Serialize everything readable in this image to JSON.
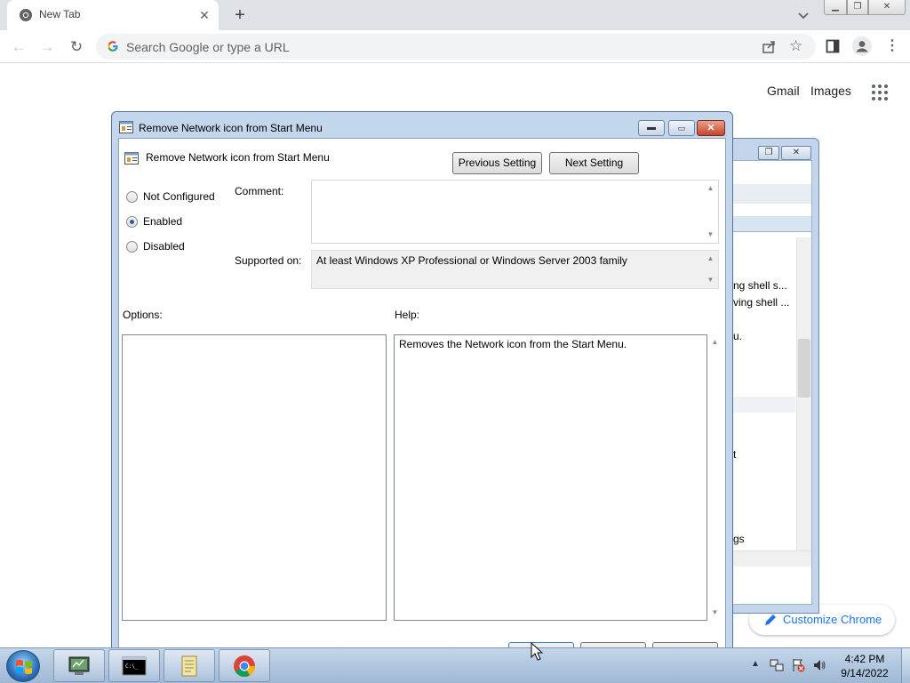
{
  "browser": {
    "tab": {
      "title": "New Tab",
      "close_glyph": "✕"
    },
    "new_tab_glyph": "+",
    "window_controls": {
      "minimize": "▁",
      "maximize": "❐",
      "close": "✕"
    },
    "nav": {
      "back": "←",
      "forward": "→",
      "reload": "↻"
    },
    "omnibox": {
      "placeholder": "Search Google or type a URL",
      "value": ""
    },
    "star_glyph": "☆",
    "menu_glyph": "⋮"
  },
  "new_tab_page": {
    "links": {
      "gmail": "Gmail",
      "images": "Images"
    },
    "customize_label": "Customize Chrome"
  },
  "background_window": {
    "lines": [
      "ng shell s...",
      "ving shell ...",
      "u.",
      "t",
      "gs"
    ],
    "buttons": {
      "restore": "❐",
      "close": "✕"
    }
  },
  "dialog": {
    "title": "Remove Network icon from Start Menu",
    "setting_name": "Remove Network icon from Start Menu",
    "title_buttons": {
      "minimize": "▬",
      "maximize": "▭",
      "close": "✕"
    },
    "buttons": {
      "previous": "Previous Setting",
      "next": "Next Setting"
    },
    "state_options": [
      {
        "label": "Not Configured",
        "checked": false
      },
      {
        "label": "Enabled",
        "checked": true
      },
      {
        "label": "Disabled",
        "checked": false
      }
    ],
    "labels": {
      "comment": "Comment:",
      "supported_on": "Supported on:",
      "options": "Options:",
      "help": "Help:"
    },
    "comment_value": "",
    "supported_on_value": "At least Windows XP Professional or Windows Server 2003 family",
    "help_text": "Removes the Network icon from the Start Menu.",
    "scroll_up_glyph": "▲",
    "scroll_down_glyph": "▼"
  },
  "taskbar": {
    "items": [
      {
        "name": "server-manager"
      },
      {
        "name": "command-prompt"
      },
      {
        "name": "notepad"
      },
      {
        "name": "chrome"
      }
    ],
    "tray_chevron": "▲",
    "clock": {
      "time": "4:42 PM",
      "date": "9/14/2022"
    }
  },
  "colors": {
    "chrome_tabstrip": "#dee1e6",
    "link_blue": "#1a73e8",
    "dialog_frame": "#c2d6ec",
    "close_button_red": "#c8442a",
    "taskbar": "#a9c0da"
  }
}
